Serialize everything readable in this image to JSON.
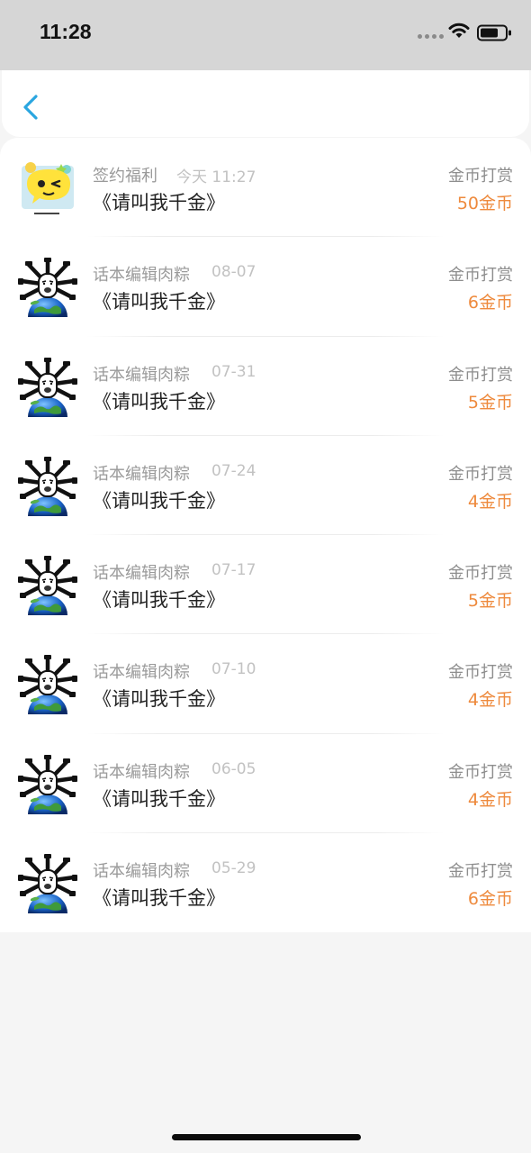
{
  "status_bar": {
    "time": "11:28"
  },
  "colors": {
    "accent": "#2aa6e0",
    "amount": "#ee8a3d"
  },
  "records": [
    {
      "avatar": "sticker-avatar",
      "sender": "签约福利",
      "date": "今天 11:27",
      "title": "《请叫我千金》",
      "type": "金币打赏",
      "amount": "50金币"
    },
    {
      "avatar": "earth-avatar",
      "sender": "话本编辑肉粽",
      "date": "08-07",
      "title": "《请叫我千金》",
      "type": "金币打赏",
      "amount": "6金币"
    },
    {
      "avatar": "earth-avatar",
      "sender": "话本编辑肉粽",
      "date": "07-31",
      "title": "《请叫我千金》",
      "type": "金币打赏",
      "amount": "5金币"
    },
    {
      "avatar": "earth-avatar",
      "sender": "话本编辑肉粽",
      "date": "07-24",
      "title": "《请叫我千金》",
      "type": "金币打赏",
      "amount": "4金币"
    },
    {
      "avatar": "earth-avatar",
      "sender": "话本编辑肉粽",
      "date": "07-17",
      "title": "《请叫我千金》",
      "type": "金币打赏",
      "amount": "5金币"
    },
    {
      "avatar": "earth-avatar",
      "sender": "话本编辑肉粽",
      "date": "07-10",
      "title": "《请叫我千金》",
      "type": "金币打赏",
      "amount": "4金币"
    },
    {
      "avatar": "earth-avatar",
      "sender": "话本编辑肉粽",
      "date": "06-05",
      "title": "《请叫我千金》",
      "type": "金币打赏",
      "amount": "4金币"
    },
    {
      "avatar": "earth-avatar",
      "sender": "话本编辑肉粽",
      "date": "05-29",
      "title": "《请叫我千金》",
      "type": "金币打赏",
      "amount": "6金币"
    }
  ]
}
